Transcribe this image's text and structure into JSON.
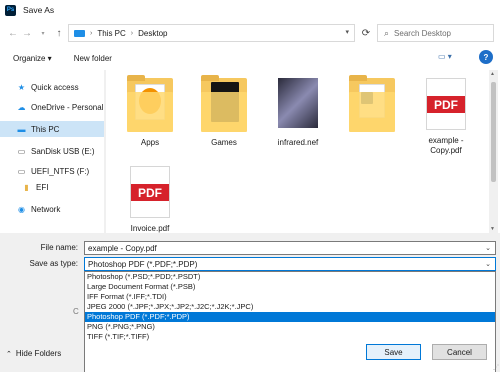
{
  "window": {
    "title": "Save As",
    "app_icon_text": "Ps"
  },
  "address": {
    "crumbs": [
      "This PC",
      "Desktop"
    ],
    "search_placeholder": "Search Desktop"
  },
  "toolbar": {
    "organize": "Organize ▾",
    "new_folder": "New folder"
  },
  "sidebar": {
    "items": [
      {
        "label": "Quick access"
      },
      {
        "label": "OneDrive - Personal"
      },
      {
        "label": "This PC"
      },
      {
        "label": "SanDisk USB (E:)"
      },
      {
        "label": "UEFI_NTFS (F:)"
      },
      {
        "label": "EFI"
      },
      {
        "label": "Network"
      }
    ]
  },
  "files": [
    {
      "label": "Apps"
    },
    {
      "label": "Games"
    },
    {
      "label": "infrared.nef"
    },
    {
      "label": ""
    },
    {
      "label": "example -\nCopy.pdf",
      "badge": "PDF"
    },
    {
      "label": "Invoice.pdf",
      "badge": "PDF"
    }
  ],
  "form": {
    "file_name_label": "File name:",
    "file_name_value": "example - Copy.pdf",
    "save_as_type_label": "Save as type:",
    "save_as_type_value": "Photoshop PDF (*.PDF;*.PDP)",
    "options": [
      "Photoshop (*.PSD;*.PDD;*.PSDT)",
      "Large Document Format (*.PSB)",
      "IFF Format (*.IFF;*.TDI)",
      "JPEG 2000 (*.JPF;*.JPX;*.JP2;*.J2C;*.J2K;*.JPC)",
      "Photoshop PDF (*.PDF;*.PDP)",
      "PNG (*.PNG;*.PNG)",
      "TIFF (*.TIF;*.TIFF)"
    ],
    "selected_option_index": 4,
    "hidden_label_fragment": "C"
  },
  "footer": {
    "hide_folders": "Hide Folders",
    "save": "Save",
    "cancel": "Cancel"
  },
  "colors": {
    "accent": "#0078d7",
    "selected_nav": "#cce4f7",
    "pdf_red": "#d6222b",
    "folder": "#ffd86e"
  }
}
